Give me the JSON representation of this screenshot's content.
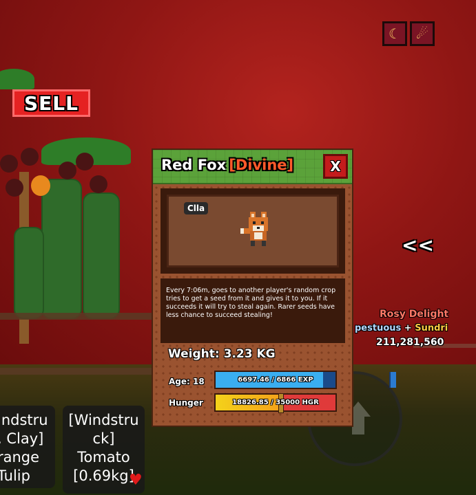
{
  "hud": {
    "top_buttons": [
      {
        "icon": "crescent-moon-icon",
        "glyph": "☾"
      },
      {
        "icon": "meteor-icon",
        "glyph": "☄"
      }
    ],
    "sell_label": "SELL",
    "chevron_label": "<<"
  },
  "billboard": {
    "line1": "Rosy Delight",
    "line2_a": "pestuous",
    "line2_sep": " + ",
    "line2_b": "Sundri",
    "line3": "211,281,560"
  },
  "inventory": [
    {
      "lines": [
        "indstru",
        ", Clay]",
        "range",
        "Tulip"
      ]
    },
    {
      "lines": [
        "[Windstru",
        "ck]",
        "Tomato",
        "[0.69kg]"
      ],
      "favorite_icon": "heart-icon"
    }
  ],
  "pet_panel": {
    "name": "Red Fox",
    "rarity": "[Divine]",
    "rarity_color": "#ff5a2a",
    "close_label": "X",
    "pet_tag": "Clla",
    "description": "Every 7:06m, goes to another player's random crop tries to get a seed from it and gives it to you. If it succeeds it will try to steal again. Rarer seeds have less chance to succeed stealing!",
    "weight_label": "Weight: 3.23 KG",
    "age_label": "Age: 18",
    "hunger_label": "Hunger",
    "exp": {
      "current": 6697.46,
      "max": 6866,
      "text": "6697.46 / 6866 EXP"
    },
    "hunger": {
      "current": 18826.85,
      "max": 35000,
      "text": "18826.85 / 35000 HGR"
    }
  }
}
